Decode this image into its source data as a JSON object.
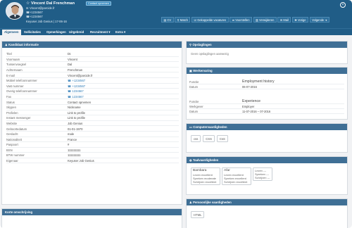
{
  "header": {
    "name": "Vincent Dal Frenchman",
    "badge": "Contact opnemen",
    "email": "Vincent@parcide.fr",
    "phone1": "+1234567",
    "phone2": "+1234567",
    "meta": "Keyuser Job Genius | 17-06-16",
    "close_icon": "close-circle-icon"
  },
  "actions": [
    {
      "icon": "file-icon",
      "label": "CV"
    },
    {
      "icon": "search-icon",
      "label": "Match"
    },
    {
      "icon": "checklist-icon",
      "label": "Gekoppelde vacatures"
    },
    {
      "icon": "send-icon",
      "label": "Voorstellen"
    },
    {
      "icon": "trash-icon",
      "label": "Verwijderen"
    },
    {
      "icon": "mail-icon",
      "label": "Mail"
    },
    {
      "icon": "plus-icon",
      "label": "Vorige"
    },
    {
      "icon": "next-icon",
      "label": "Volgende"
    }
  ],
  "tabs": [
    {
      "label": "Algemeen",
      "active": true
    },
    {
      "label": "Sollicitaties"
    },
    {
      "label": "Opmerkingen"
    },
    {
      "label": "Uitgebreid"
    },
    {
      "label": "Recruitment ▾"
    },
    {
      "label": "Extra ▾"
    }
  ],
  "info_panel": {
    "title": "Kandidaat informatie",
    "rows": [
      {
        "label": "Titel",
        "value": "Dr."
      },
      {
        "label": "Voornaam",
        "value": "Vincent"
      },
      {
        "label": "Tussenvoegsel",
        "value": "Dal"
      },
      {
        "label": "Achternaam",
        "value": "Frenchman"
      },
      {
        "label": "E-mail",
        "value": "Vincent@parcide.fr"
      },
      {
        "label": "Mobiel telefoonnummer",
        "value": "☎ +1234567",
        "link": true
      },
      {
        "label": "Vast nummer",
        "value": "☎ +1234567",
        "link": true
      },
      {
        "label": "Overig telefoonnummer",
        "value": "☎ 1234567",
        "link": true
      },
      {
        "label": "Fax",
        "value": "☎ 1234567",
        "link": true
      },
      {
        "label": "Status",
        "value": "Contact opnemen"
      },
      {
        "label": "Skypen",
        "value": "Nickname"
      },
      {
        "label": "Profielen",
        "value": "Link to profile"
      },
      {
        "label": "Instant messenger",
        "value": "Link to profile"
      },
      {
        "label": "Website",
        "value": "Job Genius"
      },
      {
        "label": "Geboortedatum",
        "value": "01-01-1970"
      },
      {
        "label": "Geslacht",
        "value": "male"
      },
      {
        "label": "Nationaliteit",
        "value": "France"
      },
      {
        "label": "Paspoort",
        "value": "#"
      },
      {
        "label": "BSN",
        "value": "111111111"
      },
      {
        "label": "BTW nummer",
        "value": "111111111"
      },
      {
        "label": "Eigenaar",
        "value": "Keyuser Job Genius"
      }
    ]
  },
  "short_panel": {
    "title": "Korte omschrijving"
  },
  "attach_panel": {
    "title": "Opslaglingen",
    "empty": "Geen opslaglingen aanwezig"
  },
  "work_panel": {
    "title": "Werkervaring",
    "entries": [
      {
        "rows": [
          {
            "label": "Functie",
            "value": "Employment history",
            "big": true
          },
          {
            "label": "Datum",
            "value": "06-07-2016"
          }
        ]
      },
      {
        "rows": [
          {
            "label": "Functie",
            "value": "Experience",
            "big": true
          },
          {
            "label": "Werkgever",
            "value": "Employer"
          },
          {
            "label": "Datum",
            "value": "11-07-2016 – 07-2016"
          }
        ]
      }
    ]
  },
  "comp_panel": {
    "title": "Computervaardigheden",
    "tags": [
      "css",
      "CSS",
      "CsS"
    ]
  },
  "lang_panel": {
    "title": "Taalvaardigheden",
    "languages": [
      {
        "name": "Bambara",
        "lines": [
          "Lezen excellent",
          "Spreken moderate",
          "Schrijven excellent"
        ]
      },
      {
        "name": "Afar",
        "lines": [
          "Lezen excellent",
          "Spreken excellent",
          "Schrijven excellent"
        ]
      },
      {
        "name": "",
        "lines": [
          "Lezen ---",
          "Spreken ---",
          "Schrijven ---"
        ]
      }
    ]
  },
  "pers_panel": {
    "title": "Persoonlijke vaardigheden",
    "tags": [
      "HTML"
    ]
  }
}
